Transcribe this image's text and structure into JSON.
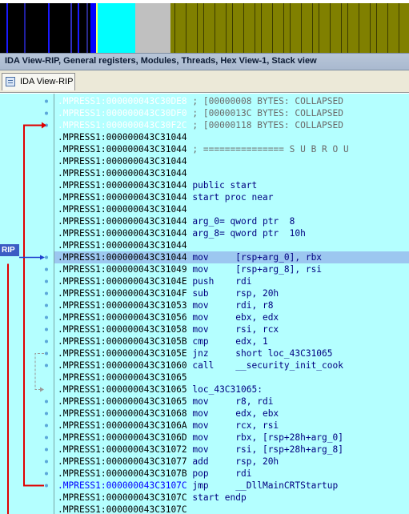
{
  "colors": {
    "code_bg": "#b4ffff",
    "highlight": "#9cc7f0",
    "arrow_red": "#e00000",
    "arrow_blue": "#2040d0",
    "arrow_gray": "#9a9a9a",
    "rip_badge": "#3b5cc4"
  },
  "nav_band": {
    "segments": [
      {
        "color": "#000000"
      },
      {
        "color": "#0000ff"
      },
      {
        "color": "#ffff66"
      },
      {
        "color": "#00ffff"
      },
      {
        "color": "#c0c0c0"
      },
      {
        "color": "#808000"
      }
    ]
  },
  "window": {
    "title": "IDA View-RIP, General registers, Modules, Threads, Hex View-1, Stack view"
  },
  "tab": {
    "icon": "ida-view-icon",
    "label": "IDA View-RIP"
  },
  "rip_label": "RIP",
  "lines": [
    {
      "addr": ".MPRESS1:000000043C30DE8",
      "style": "collapsed",
      "text": " ; [00000008 BYTES: COLLAPSED"
    },
    {
      "addr": ".MPRESS1:000000043C30DF0",
      "style": "collapsed",
      "text": " ; [0000013C BYTES: COLLAPSED"
    },
    {
      "addr": ".MPRESS1:000000043C30F2C",
      "style": "collapsed",
      "text": " ; [00000118 BYTES: COLLAPSED"
    },
    {
      "addr": ".MPRESS1:000000043C31044",
      "style": "normal",
      "text": ""
    },
    {
      "addr": ".MPRESS1:000000043C31044",
      "style": "normal",
      "text": " ; =============== S U B R O U"
    },
    {
      "addr": ".MPRESS1:000000043C31044",
      "style": "normal",
      "text": ""
    },
    {
      "addr": ".MPRESS1:000000043C31044",
      "style": "normal",
      "text": ""
    },
    {
      "addr": ".MPRESS1:000000043C31044",
      "style": "normal",
      "text": " public start"
    },
    {
      "addr": ".MPRESS1:000000043C31044",
      "style": "normal",
      "text": " start proc near"
    },
    {
      "addr": ".MPRESS1:000000043C31044",
      "style": "normal",
      "text": ""
    },
    {
      "addr": ".MPRESS1:000000043C31044",
      "style": "normal",
      "text": " arg_0= qword ptr  8"
    },
    {
      "addr": ".MPRESS1:000000043C31044",
      "style": "normal",
      "text": " arg_8= qword ptr  10h"
    },
    {
      "addr": ".MPRESS1:000000043C31044",
      "style": "normal",
      "text": ""
    },
    {
      "addr": ".MPRESS1:000000043C31044",
      "style": "highlight",
      "text": " mov     [rsp+arg_0], rbx"
    },
    {
      "addr": ".MPRESS1:000000043C31049",
      "style": "normal",
      "text": " mov     [rsp+arg_8], rsi"
    },
    {
      "addr": ".MPRESS1:000000043C3104E",
      "style": "normal",
      "text": " push    rdi"
    },
    {
      "addr": ".MPRESS1:000000043C3104F",
      "style": "normal",
      "text": " sub     rsp, 20h"
    },
    {
      "addr": ".MPRESS1:000000043C31053",
      "style": "normal",
      "text": " mov     rdi, r8"
    },
    {
      "addr": ".MPRESS1:000000043C31056",
      "style": "normal",
      "text": " mov     ebx, edx"
    },
    {
      "addr": ".MPRESS1:000000043C31058",
      "style": "normal",
      "text": " mov     rsi, rcx"
    },
    {
      "addr": ".MPRESS1:000000043C3105B",
      "style": "normal",
      "text": " cmp     edx, 1"
    },
    {
      "addr": ".MPRESS1:000000043C3105E",
      "style": "normal",
      "text": " jnz     short loc_43C31065"
    },
    {
      "addr": ".MPRESS1:000000043C31060",
      "style": "normal",
      "text": " call    __security_init_cook"
    },
    {
      "addr": ".MPRESS1:000000043C31065",
      "style": "normal",
      "text": ""
    },
    {
      "addr": ".MPRESS1:000000043C31065",
      "style": "normal",
      "text": " loc_43C31065:"
    },
    {
      "addr": ".MPRESS1:000000043C31065",
      "style": "normal",
      "text": " mov     r8, rdi"
    },
    {
      "addr": ".MPRESS1:000000043C31068",
      "style": "normal",
      "text": " mov     edx, ebx"
    },
    {
      "addr": ".MPRESS1:000000043C3106A",
      "style": "normal",
      "text": " mov     rcx, rsi"
    },
    {
      "addr": ".MPRESS1:000000043C3106D",
      "style": "normal",
      "text": " mov     rbx, [rsp+28h+arg_0]"
    },
    {
      "addr": ".MPRESS1:000000043C31072",
      "style": "normal",
      "text": " mov     rsi, [rsp+28h+arg_8]"
    },
    {
      "addr": ".MPRESS1:000000043C31077",
      "style": "normal",
      "text": " add     rsp, 20h"
    },
    {
      "addr": ".MPRESS1:000000043C3107B",
      "style": "normal",
      "text": " pop     rdi"
    },
    {
      "addr": ".MPRESS1:000000043C3107C",
      "style": "blue",
      "text": " jmp     __DllMainCRTStartup"
    },
    {
      "addr": ".MPRESS1:000000043C3107C",
      "style": "normal",
      "text": " start endp"
    },
    {
      "addr": ".MPRESS1:000000043C3107C",
      "style": "normal",
      "text": ""
    }
  ]
}
